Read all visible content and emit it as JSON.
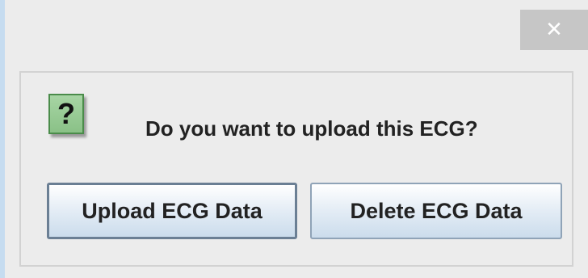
{
  "dialog": {
    "close_glyph": "✕",
    "icon": "question-mark-icon",
    "icon_glyph": "?",
    "message": "Do you want to upload this ECG?",
    "buttons": {
      "upload_label": "Upload ECG Data",
      "delete_label": "Delete ECG Data"
    }
  },
  "colors": {
    "icon_fill": "#a7d5a4",
    "close_button": "#c6c6c6",
    "background": "#ececec"
  }
}
